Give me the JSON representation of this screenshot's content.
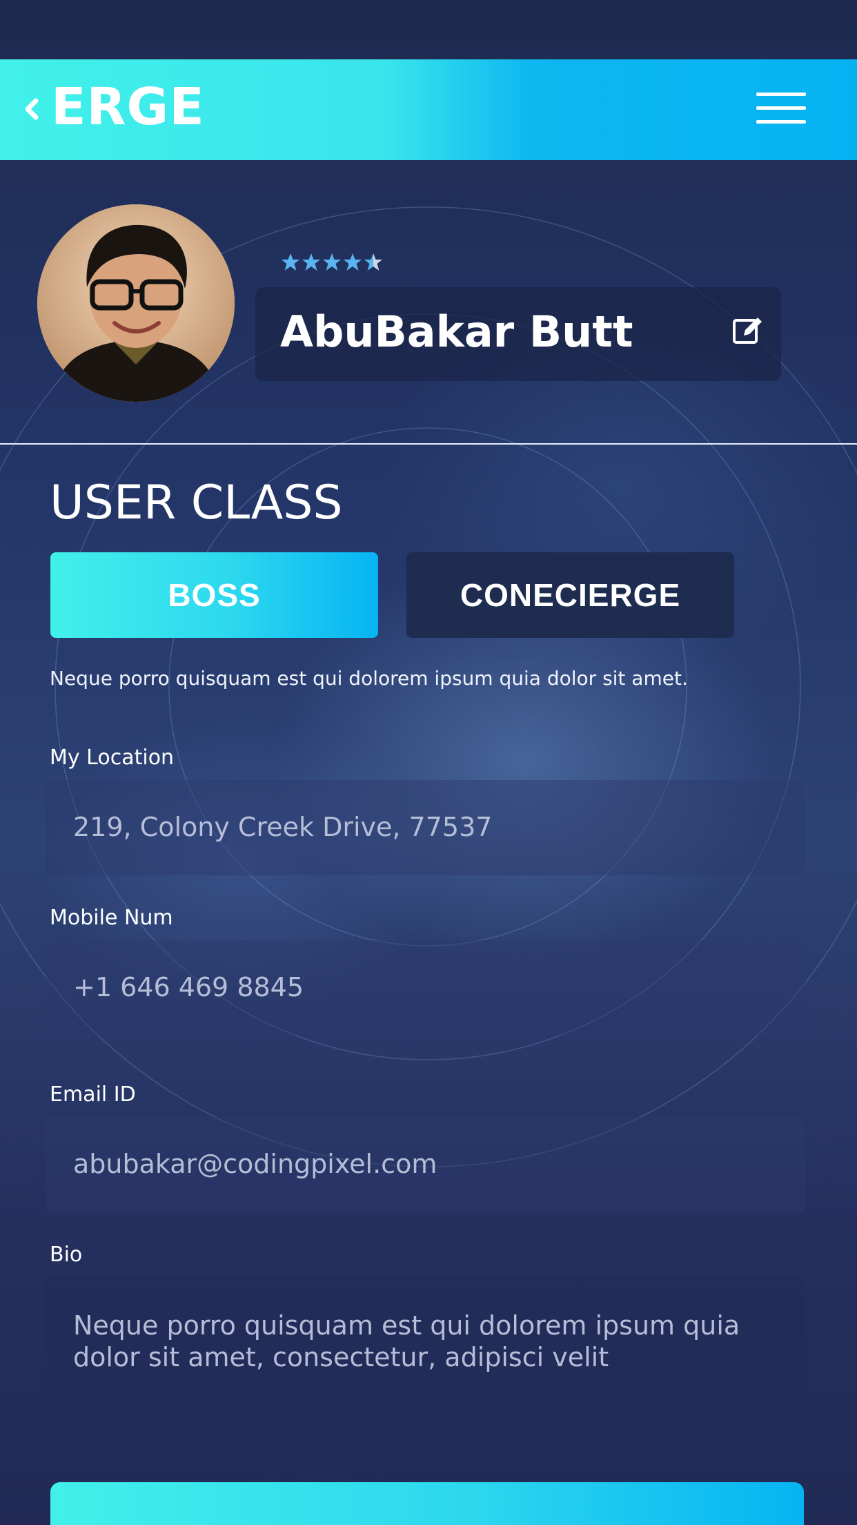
{
  "header": {
    "back_icon": "chevron-left-icon",
    "brand": "ERGE",
    "menu_icon": "hamburger-menu-icon",
    "colors": {
      "gradient_start": "#41f0ea",
      "gradient_end": "#05b3f3"
    }
  },
  "profile": {
    "name": "AbuBakar Butt",
    "rating": 4.5,
    "rating_max": 5,
    "edit_icon": "edit-icon"
  },
  "user_class": {
    "title": "USER CLASS",
    "options": [
      "BOSS",
      "CONECIERGE"
    ],
    "selected": "BOSS",
    "description": "Neque porro quisquam est qui dolorem ipsum quia dolor sit amet."
  },
  "form": {
    "location": {
      "label": "My Location",
      "value": "219, Colony Creek Drive, 77537"
    },
    "mobile": {
      "label": "Mobile Num",
      "value": "+1 646 469 8845"
    },
    "email": {
      "label": "Email ID",
      "value": "abubakar@codingpixel.com"
    },
    "bio": {
      "label": "Bio",
      "value": "Neque porro quisquam est qui dolorem ipsum quia dolor sit amet, consectetur, adipisci velit"
    }
  },
  "colors": {
    "accent": "#05b3f3",
    "star": "#5ab4f0",
    "selected_button": "#2dd8ee",
    "unselected_button": "#1e2c50"
  }
}
